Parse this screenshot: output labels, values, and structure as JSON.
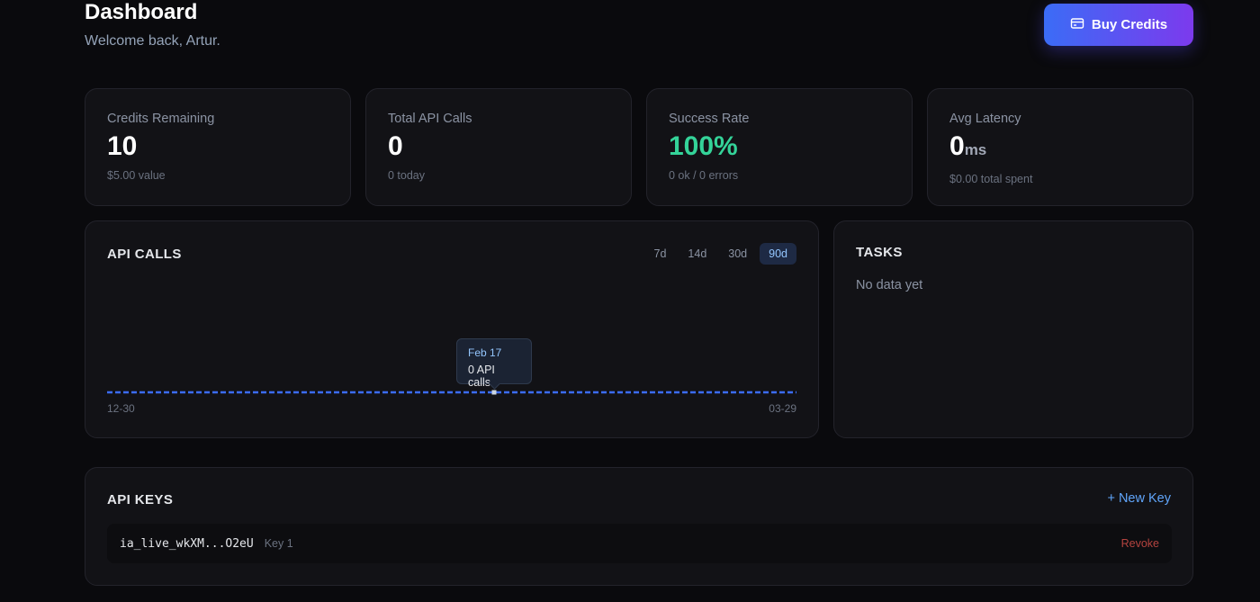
{
  "header": {
    "title": "Dashboard",
    "subtitle": "Welcome back, Artur.",
    "buy_credits_label": "Buy Credits",
    "buy_credits_icon": "credit-card-icon"
  },
  "stats": [
    {
      "label": "Credits Remaining",
      "value": "10",
      "unit": "",
      "sub": "$5.00 value",
      "color": "#ffffff"
    },
    {
      "label": "Total API Calls",
      "value": "0",
      "unit": "",
      "sub": "0 today",
      "color": "#ffffff"
    },
    {
      "label": "Success Rate",
      "value": "100%",
      "unit": "",
      "sub": "0 ok / 0 errors",
      "color": "#34d399"
    },
    {
      "label": "Avg Latency",
      "value": "0",
      "unit": "ms",
      "sub": "$0.00 total spent",
      "color": "#ffffff"
    }
  ],
  "api_calls": {
    "title": "API CALLS",
    "ranges": [
      "7d",
      "14d",
      "30d",
      "90d"
    ],
    "active_range": "90d",
    "x_start_label": "12-30",
    "x_end_label": "03-29",
    "tooltip": {
      "date": "Feb 17",
      "value": "0 API calls"
    },
    "line_color": "#3b6cf6"
  },
  "chart_data": {
    "type": "line",
    "x_range": [
      "12-30",
      "03-29"
    ],
    "series": [
      {
        "values": [
          0,
          0,
          0,
          0,
          0,
          0,
          0,
          0,
          0,
          0,
          0,
          0,
          0,
          0
        ]
      }
    ]
  },
  "tasks": {
    "title": "TASKS",
    "empty_text": "No data yet"
  },
  "api_keys": {
    "title": "API KEYS",
    "new_key_label": "+ New Key",
    "keys": [
      {
        "value": "ia_live_wkXM...O2eU",
        "name": "Key 1",
        "action": "Revoke"
      }
    ]
  }
}
